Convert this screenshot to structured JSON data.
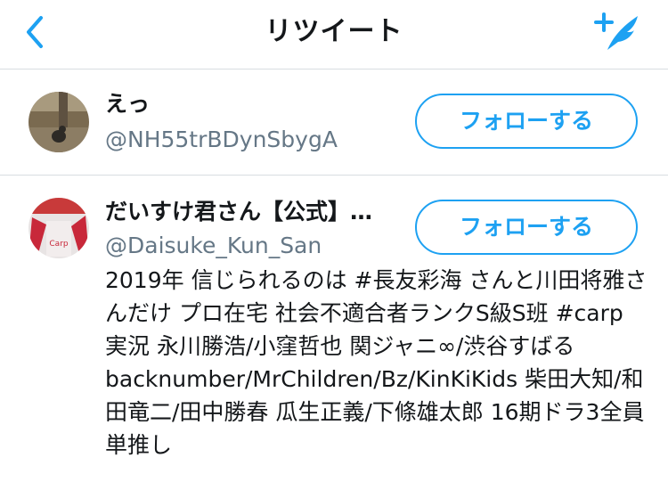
{
  "header": {
    "title": "リツイート",
    "back_icon": "chevron-left-icon",
    "compose_icon": "compose-tweet-icon"
  },
  "colors": {
    "accent": "#1da1f2",
    "secondary_text": "#657786",
    "divider": "#d8dde1"
  },
  "users": [
    {
      "name": "えっ",
      "handle": "@NH55trBDynSbygA",
      "follow_label": "フォローする",
      "avatar": "photo-avatar"
    },
    {
      "name": "だいすけ君さん【公式】…",
      "handle": "@Daisuke_Kun_San",
      "follow_label": "フォローする",
      "avatar": "photo-avatar",
      "bio": "2019年 信じられるのは #長友彩海 さんと川田将雅さんだけ プロ在宅 社会不適合者ランクS級S班 #carp 実況 永川勝浩/小窪哲也 関ジャニ∞/渋谷すばる backnumber/MrChildren/Bz/KinKiKids 柴田大知/和田竜二/田中勝春 瓜生正義/下條雄太郎 16期ドラ3全員単推し"
    }
  ]
}
